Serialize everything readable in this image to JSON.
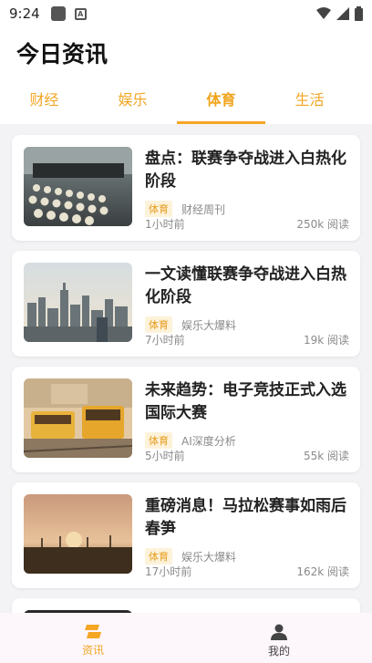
{
  "status_bar": {
    "time": "9:24",
    "notif_letter": "A"
  },
  "header": {
    "title": "今日资讯"
  },
  "tabs": [
    {
      "label": "财经",
      "active": false
    },
    {
      "label": "娱乐",
      "active": false
    },
    {
      "label": "体育",
      "active": true
    },
    {
      "label": "生活",
      "active": false
    }
  ],
  "articles": [
    {
      "title": "盘点：联赛争夺战进入白热化阶段",
      "tag": "体育",
      "source": "财经周刊",
      "time": "1小时前",
      "reads": "250k 阅读",
      "thumb": "typewriter"
    },
    {
      "title": "一文读懂联赛争夺战进入白热化阶段",
      "tag": "体育",
      "source": "娱乐大爆料",
      "time": "7小时前",
      "reads": "19k 阅读",
      "thumb": "city"
    },
    {
      "title": "未来趋势：电子竞技正式入选国际大赛",
      "tag": "体育",
      "source": "AI深度分析",
      "time": "5小时前",
      "reads": "55k 阅读",
      "thumb": "tram"
    },
    {
      "title": "重磅消息！马拉松赛事如雨后春笋",
      "tag": "体育",
      "source": "娱乐大爆料",
      "time": "17小时前",
      "reads": "162k 阅读",
      "thumb": "sunset"
    }
  ],
  "bottom_nav": [
    {
      "label": "资讯",
      "icon": "news-icon",
      "active": true
    },
    {
      "label": "我的",
      "icon": "person-icon",
      "active": false
    }
  ],
  "colors": {
    "accent": "#f5a623",
    "tag_bg": "#fdf2da"
  }
}
